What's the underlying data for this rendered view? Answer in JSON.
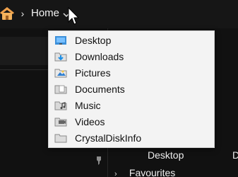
{
  "breadcrumb": {
    "separator": "›",
    "current": "Home"
  },
  "dropdown": {
    "items": [
      {
        "label": "Desktop",
        "icon": "desktop-folder-icon"
      },
      {
        "label": "Downloads",
        "icon": "downloads-folder-icon"
      },
      {
        "label": "Pictures",
        "icon": "pictures-folder-icon"
      },
      {
        "label": "Documents",
        "icon": "documents-folder-icon"
      },
      {
        "label": "Music",
        "icon": "music-folder-icon"
      },
      {
        "label": "Videos",
        "icon": "videos-folder-icon"
      },
      {
        "label": "CrystalDiskInfo",
        "icon": "folder-icon"
      }
    ]
  },
  "main": {
    "desktop_label": "Desktop",
    "right_partial_label": "D",
    "favourites_label": "Favourites"
  },
  "colors": {
    "background": "#101010",
    "menu_background": "#f3f3f3",
    "text_dark": "#111111",
    "text_light": "#f0f0f0"
  }
}
